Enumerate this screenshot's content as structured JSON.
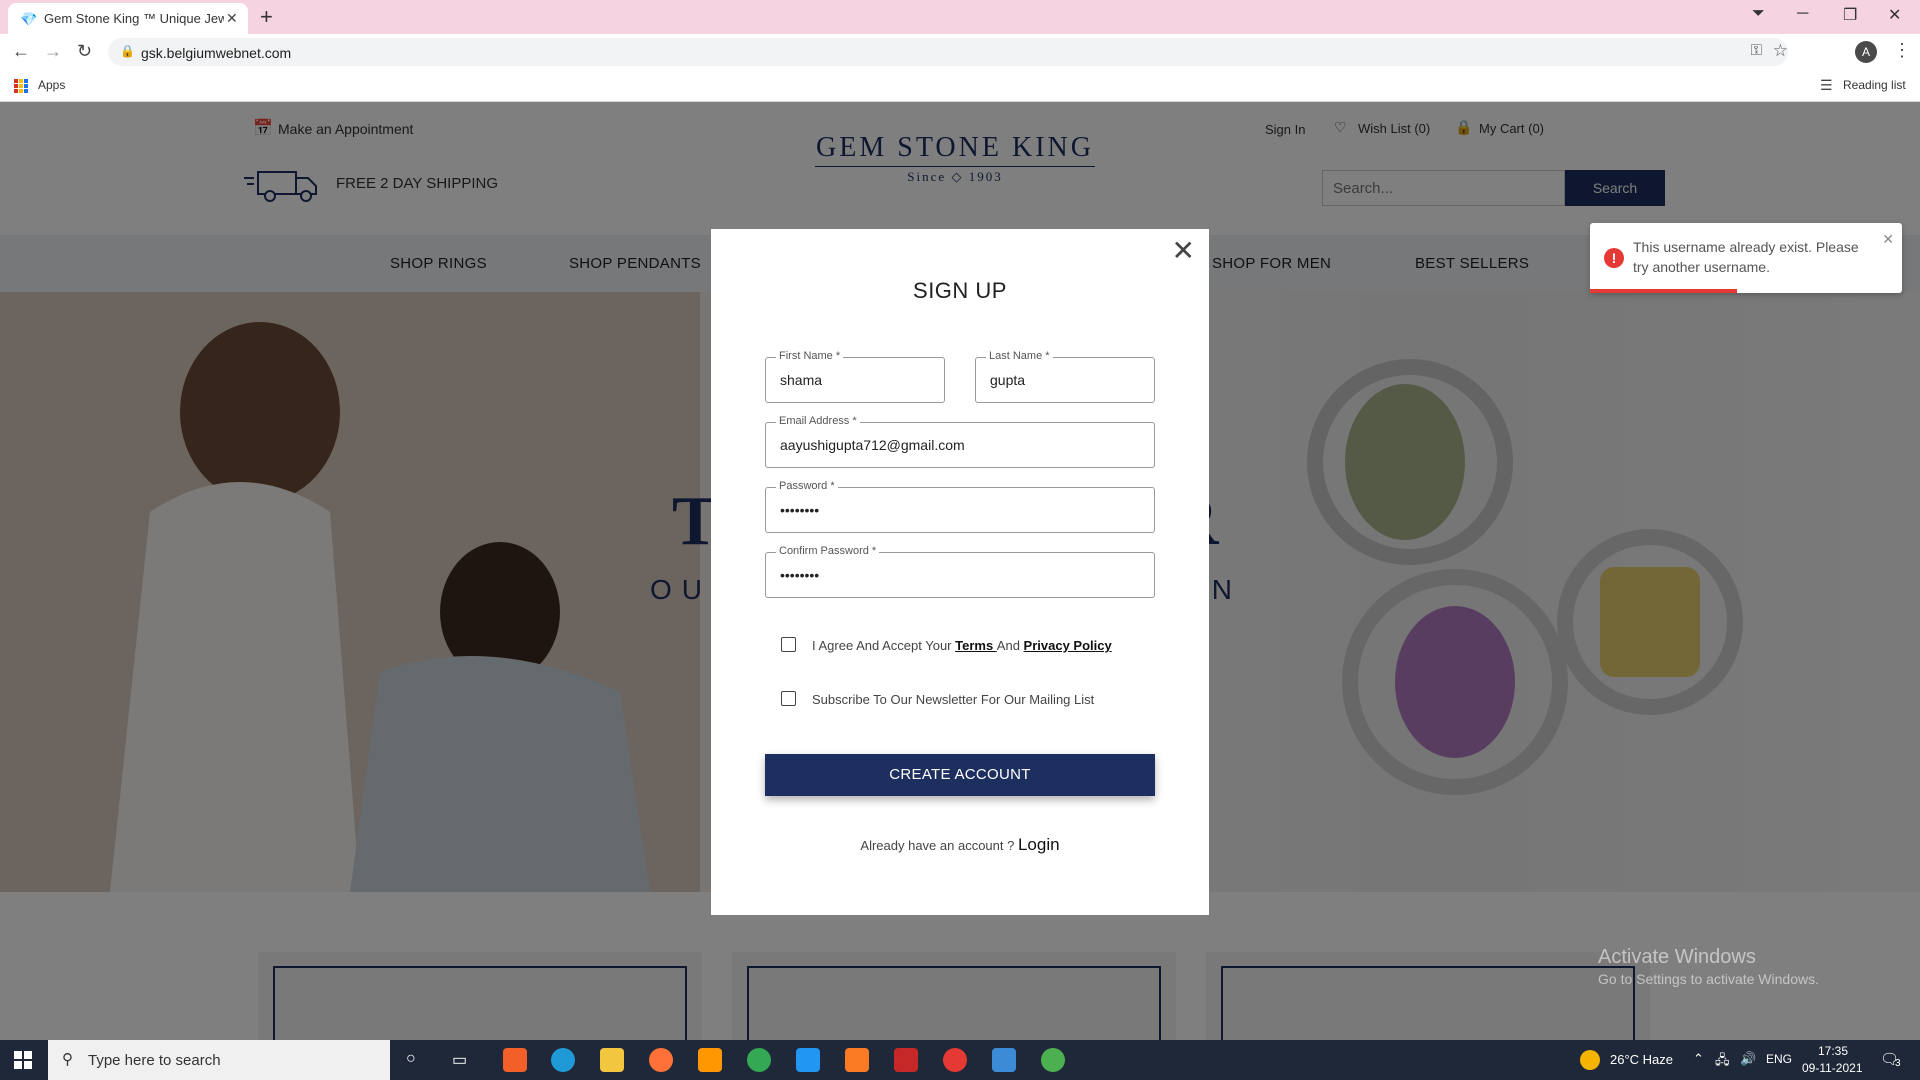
{
  "browser": {
    "tab_title": "Gem Stone King ™ Unique Jeweli",
    "url": "gsk.belgiumwebnet.com",
    "profile_initial": "A",
    "bookmarks": {
      "apps_label": "Apps",
      "reading_list_label": "Reading list"
    }
  },
  "header": {
    "appointment_label": "Make an Appointment",
    "shipping_label": "FREE 2 DAY SHIPPING",
    "logo_title": "GEM STONE KING",
    "logo_since": "Since",
    "logo_year": "1903",
    "sign_in_label": "Sign In",
    "wishlist_label": "Wish List (0)",
    "cart_label": "My Cart (0)",
    "search_placeholder": "Search...",
    "search_button": "Search"
  },
  "menu": {
    "items": [
      "SHOP RINGS",
      "SHOP PENDANTS",
      "SHOP FOR MEN",
      "BEST SELLERS"
    ]
  },
  "hero": {
    "title_left": "T",
    "title_right": "R",
    "subtitle_left": "OUR",
    "subtitle_right": "ON"
  },
  "modal": {
    "title": "SIGN UP",
    "first_name": {
      "label": "First Name *",
      "value": "shama"
    },
    "last_name": {
      "label": "Last Name *",
      "value": "gupta"
    },
    "email": {
      "label": "Email Address *",
      "value": "aayushigupta712@gmail.com"
    },
    "password": {
      "label": "Password *",
      "value": "••••••••"
    },
    "confirm_password": {
      "label": "Confirm Password *",
      "value": "••••••••"
    },
    "agree_prefix": "I Agree And Accept Your ",
    "terms_link": "Terms ",
    "agree_and": "And ",
    "privacy_link": "Privacy Policy",
    "agree_checked": false,
    "newsletter_label": "Subscribe To Our Newsletter For Our Mailing List",
    "newsletter_checked": false,
    "create_button": "CREATE ACCOUNT",
    "login_prompt": "Already have an account ? ",
    "login_link": "Login"
  },
  "toast": {
    "message": "This username already exist. Please try another username.",
    "progress_fraction": 0.47,
    "color": "#e53935"
  },
  "watermark": {
    "title": "Activate Windows",
    "subtitle": "Go to Settings to activate Windows."
  },
  "taskbar": {
    "search_placeholder": "Type here to search",
    "weather": "26°C  Haze",
    "language": "ENG",
    "time": "17:35",
    "date": "09-11-2021",
    "notification_count": "3"
  },
  "colors": {
    "brand_navy": "#1c2f5e",
    "tab_strip": "#f6d3e0",
    "error_red": "#e53935"
  }
}
